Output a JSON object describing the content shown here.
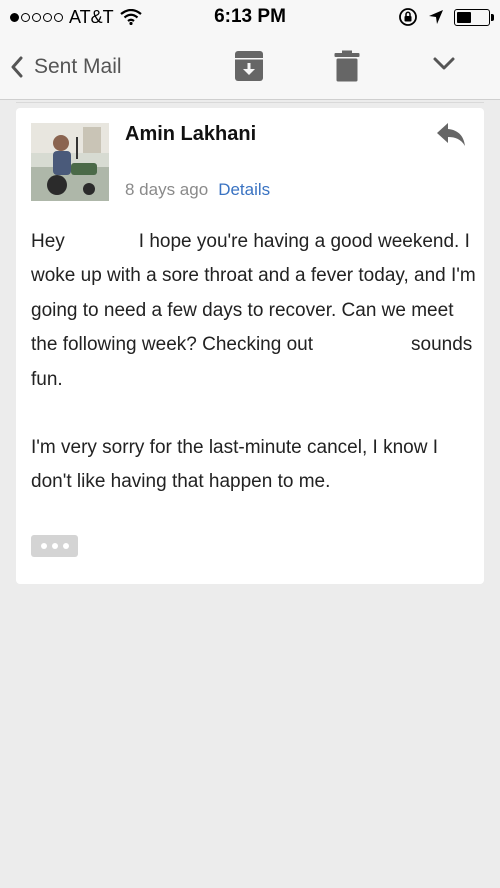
{
  "status_bar": {
    "carrier": "AT&T",
    "time": "6:13 PM",
    "signal_bars_filled": 1,
    "signal_bars_total": 5,
    "battery_level": 0.45
  },
  "nav": {
    "back_label": "Sent Mail",
    "icons": [
      "chevron-left-icon",
      "archive-icon",
      "trash-icon",
      "chevron-down-icon"
    ]
  },
  "message": {
    "sender": "Amin Lakhani",
    "age": "8 days ago",
    "details_label": "Details",
    "body": {
      "greeting": "Hey",
      "line1_after_greeting": "I hope you're having a good weekend. I woke up with a sore throat and a fever today, and I'm going to need a few days to recover. Can we meet the following week? Checking out",
      "line1_end": "sounds fun.",
      "paragraph2": "I'm very sorry for the last-minute cancel, I know I don't like having that happen to me."
    }
  },
  "colors": {
    "link": "#3a73c2",
    "background": "#ececec",
    "card": "#ffffff"
  }
}
